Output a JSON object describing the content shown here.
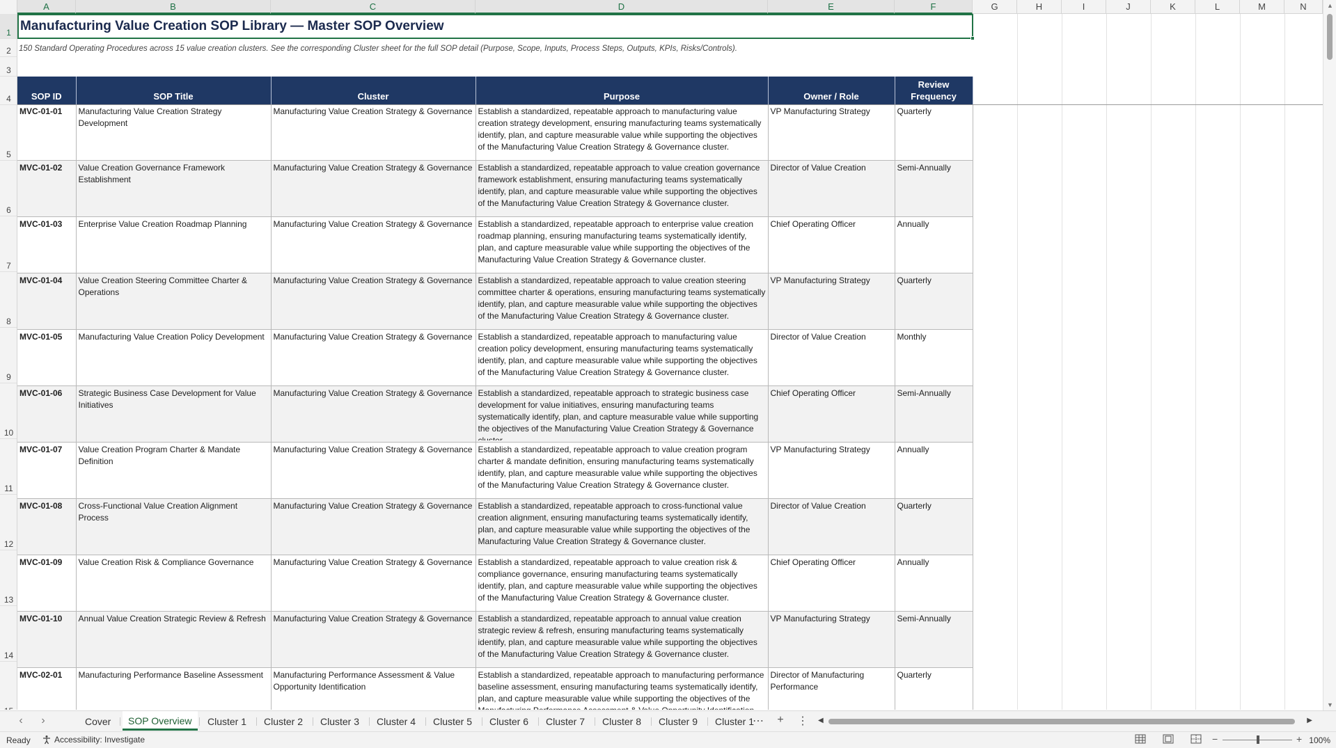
{
  "columns": [
    "A",
    "B",
    "C",
    "D",
    "E",
    "F",
    "G",
    "H",
    "I",
    "J",
    "K",
    "L",
    "M",
    "N"
  ],
  "rows": [
    "1",
    "2",
    "3",
    "4",
    "5",
    "6",
    "7",
    "8",
    "9",
    "10",
    "11",
    "12",
    "13",
    "14",
    "15"
  ],
  "title": "Manufacturing Value Creation SOP Library — Master SOP Overview",
  "subtitle": "150 Standard Operating Procedures across 15 value creation clusters. See the corresponding Cluster sheet for the full SOP detail (Purpose, Scope, Inputs, Process Steps, Outputs, KPIs, Risks/Controls).",
  "table": {
    "headers": [
      "SOP ID",
      "SOP Title",
      "Cluster",
      "Purpose",
      "Owner / Role",
      "Review Frequency"
    ],
    "rows": [
      {
        "id": "MVC-01-01",
        "title": "Manufacturing Value Creation Strategy Development",
        "cluster": "Manufacturing Value Creation Strategy & Governance",
        "purpose": "Establish a standardized, repeatable approach to manufacturing value creation strategy development, ensuring manufacturing teams systematically identify, plan, and capture measurable value while supporting the objectives of the Manufacturing Value Creation Strategy & Governance cluster.",
        "owner": "VP Manufacturing Strategy",
        "freq": "Quarterly"
      },
      {
        "id": "MVC-01-02",
        "title": "Value Creation Governance Framework Establishment",
        "cluster": "Manufacturing Value Creation Strategy & Governance",
        "purpose": "Establish a standardized, repeatable approach to value creation governance framework establishment, ensuring manufacturing teams systematically identify, plan, and capture measurable value while supporting the objectives of the Manufacturing Value Creation Strategy & Governance cluster.",
        "owner": "Director of Value Creation",
        "freq": "Semi-Annually"
      },
      {
        "id": "MVC-01-03",
        "title": "Enterprise Value Creation Roadmap Planning",
        "cluster": "Manufacturing Value Creation Strategy & Governance",
        "purpose": "Establish a standardized, repeatable approach to enterprise value creation roadmap planning, ensuring manufacturing teams systematically identify, plan, and capture measurable value while supporting the objectives of the Manufacturing Value Creation Strategy & Governance cluster.",
        "owner": "Chief Operating Officer",
        "freq": "Annually"
      },
      {
        "id": "MVC-01-04",
        "title": "Value Creation Steering Committee Charter & Operations",
        "cluster": "Manufacturing Value Creation Strategy & Governance",
        "purpose": "Establish a standardized, repeatable approach to value creation steering committee charter & operations, ensuring manufacturing teams systematically identify, plan, and capture measurable value while supporting the objectives of the Manufacturing Value Creation Strategy & Governance cluster.",
        "owner": "VP Manufacturing Strategy",
        "freq": "Quarterly"
      },
      {
        "id": "MVC-01-05",
        "title": "Manufacturing Value Creation Policy Development",
        "cluster": "Manufacturing Value Creation Strategy & Governance",
        "purpose": "Establish a standardized, repeatable approach to manufacturing value creation policy development, ensuring manufacturing teams systematically identify, plan, and capture measurable value while supporting the objectives of the Manufacturing Value Creation Strategy & Governance cluster.",
        "owner": "Director of Value Creation",
        "freq": "Monthly"
      },
      {
        "id": "MVC-01-06",
        "title": "Strategic Business Case Development for Value Initiatives",
        "cluster": "Manufacturing Value Creation Strategy & Governance",
        "purpose": "Establish a standardized, repeatable approach to strategic business case development for value initiatives, ensuring manufacturing teams systematically identify, plan, and capture measurable value while supporting the objectives of the Manufacturing Value Creation Strategy & Governance cluster.",
        "owner": "Chief Operating Officer",
        "freq": "Semi-Annually"
      },
      {
        "id": "MVC-01-07",
        "title": "Value Creation Program Charter & Mandate Definition",
        "cluster": "Manufacturing Value Creation Strategy & Governance",
        "purpose": "Establish a standardized, repeatable approach to value creation program charter & mandate definition, ensuring manufacturing teams systematically identify, plan, and capture measurable value while supporting the objectives of the Manufacturing Value Creation Strategy & Governance cluster.",
        "owner": "VP Manufacturing Strategy",
        "freq": "Annually"
      },
      {
        "id": "MVC-01-08",
        "title": "Cross-Functional Value Creation Alignment Process",
        "cluster": "Manufacturing Value Creation Strategy & Governance",
        "purpose": "Establish a standardized, repeatable approach to cross-functional value creation alignment, ensuring manufacturing teams systematically identify, plan, and capture measurable value while supporting the objectives of the Manufacturing Value Creation Strategy & Governance cluster.",
        "owner": "Director of Value Creation",
        "freq": "Quarterly"
      },
      {
        "id": "MVC-01-09",
        "title": "Value Creation Risk & Compliance Governance",
        "cluster": "Manufacturing Value Creation Strategy & Governance",
        "purpose": "Establish a standardized, repeatable approach to value creation risk & compliance governance, ensuring manufacturing teams systematically identify, plan, and capture measurable value while supporting the objectives of the Manufacturing Value Creation Strategy & Governance cluster.",
        "owner": "Chief Operating Officer",
        "freq": "Annually"
      },
      {
        "id": "MVC-01-10",
        "title": "Annual Value Creation Strategic Review & Refresh",
        "cluster": "Manufacturing Value Creation Strategy & Governance",
        "purpose": "Establish a standardized, repeatable approach to annual value creation strategic review & refresh, ensuring manufacturing teams systematically identify, plan, and capture measurable value while supporting the objectives of the Manufacturing Value Creation Strategy & Governance cluster.",
        "owner": "VP Manufacturing Strategy",
        "freq": "Semi-Annually"
      },
      {
        "id": "MVC-02-01",
        "title": "Manufacturing Performance Baseline Assessment",
        "cluster": "Manufacturing Performance Assessment & Value Opportunity Identification",
        "purpose": "Establish a standardized, repeatable approach to manufacturing performance baseline assessment, ensuring manufacturing teams systematically identify, plan, and capture measurable value while supporting the objectives of the Manufacturing Performance Assessment & Value Opportunity Identification cluster.",
        "owner": "Director of Manufacturing Performance",
        "freq": "Quarterly"
      }
    ]
  },
  "sheet_tabs": [
    "Cover",
    "SOP Overview",
    "Cluster 1",
    "Cluster 2",
    "Cluster 3",
    "Cluster 4",
    "Cluster 5",
    "Cluster 6",
    "Cluster 7",
    "Cluster 8",
    "Cluster 9",
    "Cluster 1"
  ],
  "active_tab": "SOP Overview",
  "status": {
    "ready": "Ready",
    "accessibility": "Accessibility: Investigate",
    "zoom": "100%"
  },
  "colors": {
    "header_bg": "#1f3864",
    "accent": "#217346",
    "title": "#1b2a4e"
  }
}
